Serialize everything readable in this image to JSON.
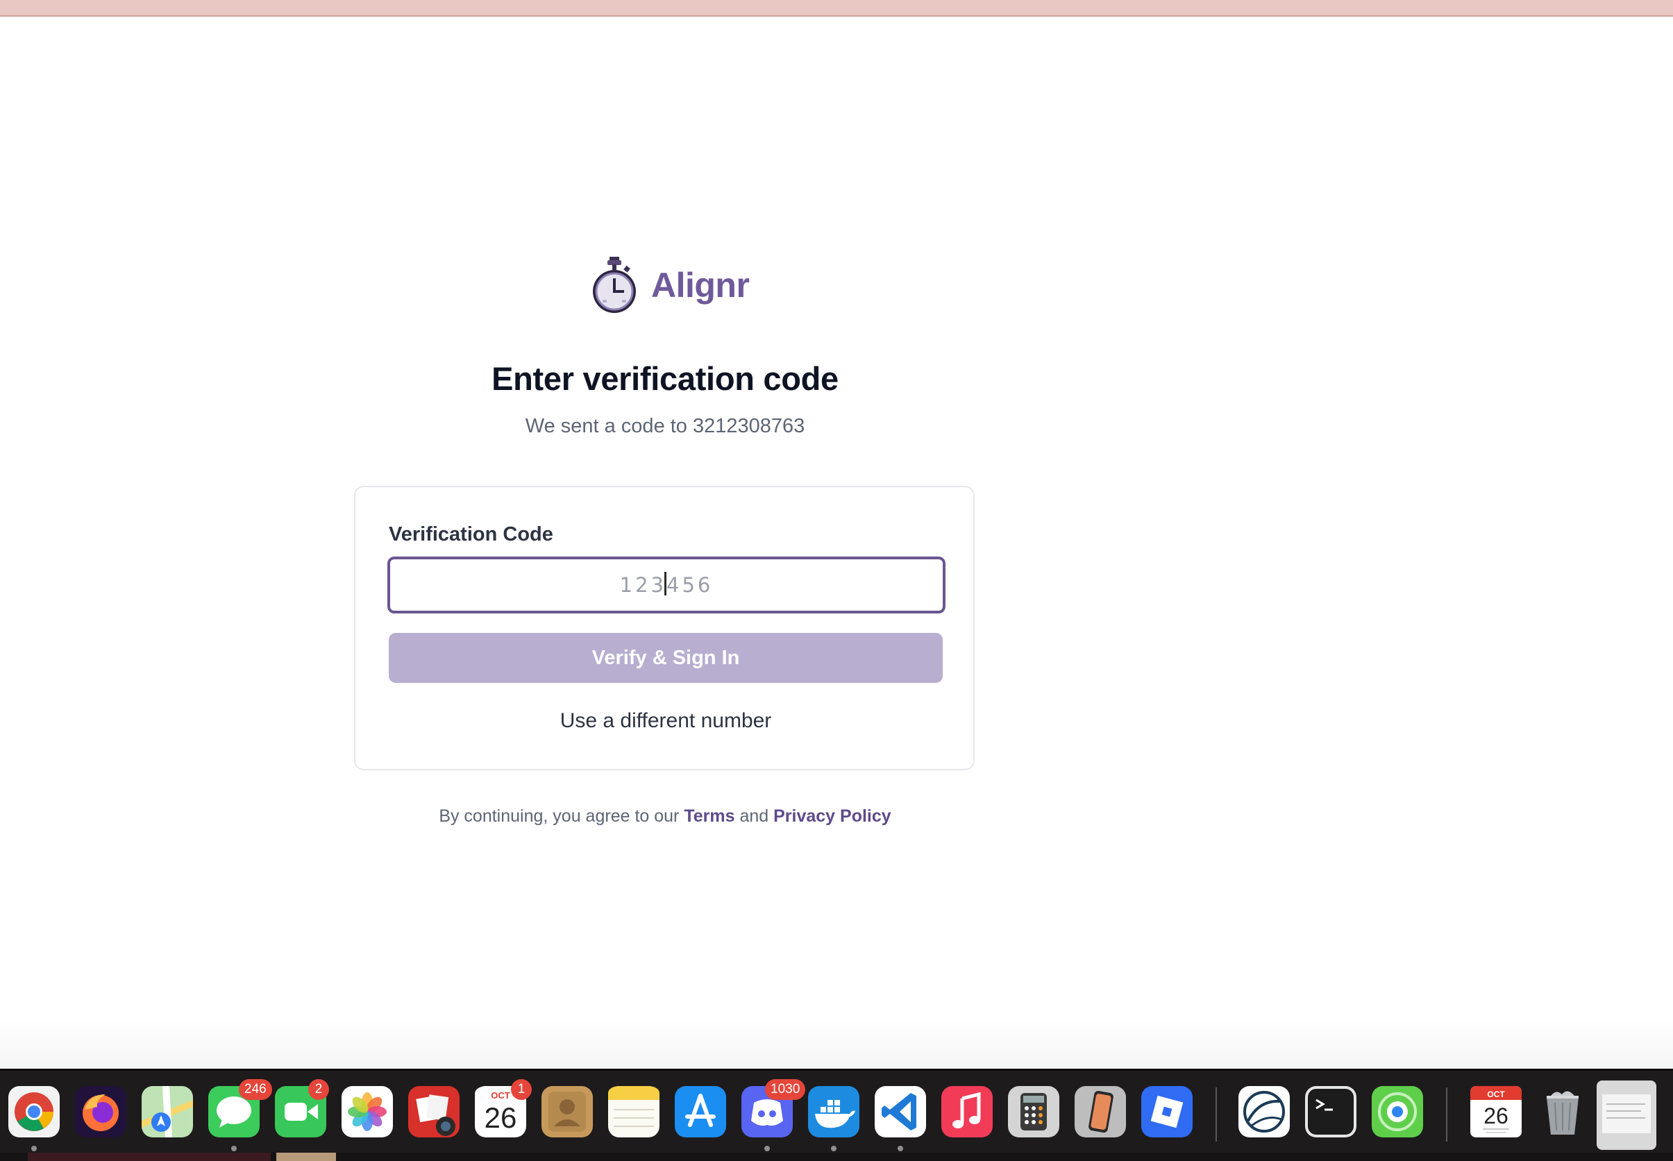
{
  "brand": {
    "name": "Alignr",
    "logo_icon": "stopwatch-icon"
  },
  "heading": {
    "title": "Enter verification code",
    "subtitle": "We sent a code to 3212308763"
  },
  "form": {
    "label": "Verification Code",
    "placeholder": "123456",
    "value": "",
    "submit_label": "Verify & Sign In",
    "alt_link": "Use a different number"
  },
  "legal": {
    "prefix": "By continuing, you agree to our ",
    "terms": "Terms",
    "joiner": " and ",
    "privacy": "Privacy Policy"
  },
  "colors": {
    "brand_purple": "#6e5a9b",
    "input_border": "#6a5693",
    "button_disabled": "#b7aed0",
    "heading": "#0f1424",
    "muted": "#5d6473",
    "top_bar": "#e9c7c2"
  },
  "dock": {
    "apps": [
      {
        "name": "Google Chrome",
        "icon": "chrome-icon"
      },
      {
        "name": "Firefox",
        "icon": "firefox-icon"
      },
      {
        "name": "Maps",
        "icon": "maps-icon"
      },
      {
        "name": "Messages",
        "icon": "messages-icon",
        "badge": "246"
      },
      {
        "name": "FaceTime",
        "icon": "facetime-icon",
        "badge": "2"
      },
      {
        "name": "Photos",
        "icon": "photos-icon"
      },
      {
        "name": "Photo Booth",
        "icon": "photo-booth-icon"
      },
      {
        "name": "Calendar",
        "icon": "calendar-icon",
        "badge": "1",
        "month": "OCT",
        "day": "26"
      },
      {
        "name": "Contacts",
        "icon": "contacts-icon"
      },
      {
        "name": "Notes",
        "icon": "notes-icon"
      },
      {
        "name": "App Store",
        "icon": "app-store-icon"
      },
      {
        "name": "Discord",
        "icon": "discord-icon",
        "badge": "1030"
      },
      {
        "name": "Docker",
        "icon": "docker-icon"
      },
      {
        "name": "Visual Studio Code",
        "icon": "vscode-icon"
      },
      {
        "name": "Music",
        "icon": "music-icon"
      },
      {
        "name": "Calculator",
        "icon": "calculator-icon"
      },
      {
        "name": "iPhone Mirroring",
        "icon": "iphone-mirroring-icon"
      },
      {
        "name": "Roblox",
        "icon": "roblox-icon"
      },
      {
        "name": "Network Radar",
        "icon": "network-radar-icon"
      },
      {
        "name": "Terminal",
        "icon": "terminal-icon"
      },
      {
        "name": "Find My",
        "icon": "find-my-icon"
      },
      {
        "name": "Calendar Widget",
        "icon": "calendar-widget-icon",
        "month": "OCT",
        "day": "26"
      },
      {
        "name": "Trash",
        "icon": "trash-icon"
      }
    ]
  }
}
